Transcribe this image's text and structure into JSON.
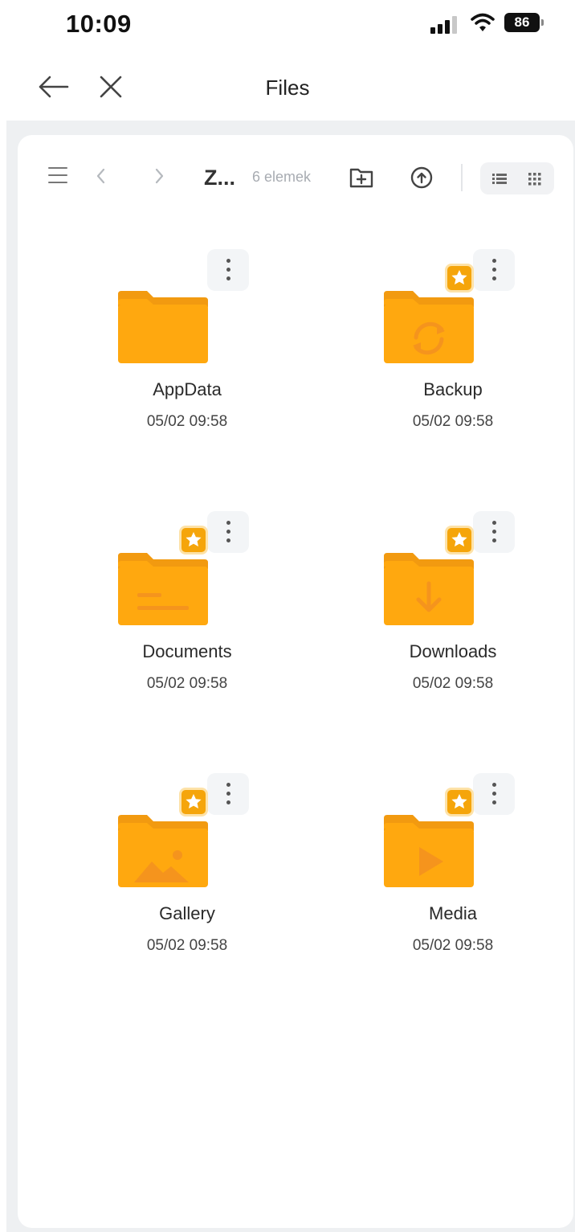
{
  "status_bar": {
    "time": "10:09",
    "battery": "86"
  },
  "nav": {
    "title": "Files",
    "back_icon": "arrow-left-icon",
    "close_icon": "close-icon"
  },
  "toolbar": {
    "path": "Z...",
    "item_count": "6 elemek",
    "icons": [
      "menu-icon",
      "chevron-left-icon",
      "chevron-right-icon",
      "new-folder-icon",
      "upload-icon",
      "list-view-icon",
      "grid-view-icon"
    ]
  },
  "colors": {
    "folder": "#FFA80F",
    "folder_tab": "#F29A10",
    "folder_symbol": "#F5941D",
    "star_badge": "#F5A50B",
    "panel_bg": "#EEF0F2"
  },
  "folders": [
    {
      "name": "AppData",
      "date": "05/02 09:58",
      "starred": false,
      "symbol": "none"
    },
    {
      "name": "Backup",
      "date": "05/02 09:58",
      "starred": true,
      "symbol": "sync-icon"
    },
    {
      "name": "Documents",
      "date": "05/02 09:58",
      "starred": true,
      "symbol": "document-lines-icon"
    },
    {
      "name": "Downloads",
      "date": "05/02 09:58",
      "starred": true,
      "symbol": "download-arrow-icon"
    },
    {
      "name": "Gallery",
      "date": "05/02 09:58",
      "starred": true,
      "symbol": "image-icon"
    },
    {
      "name": "Media",
      "date": "05/02 09:58",
      "starred": true,
      "symbol": "play-icon"
    }
  ]
}
